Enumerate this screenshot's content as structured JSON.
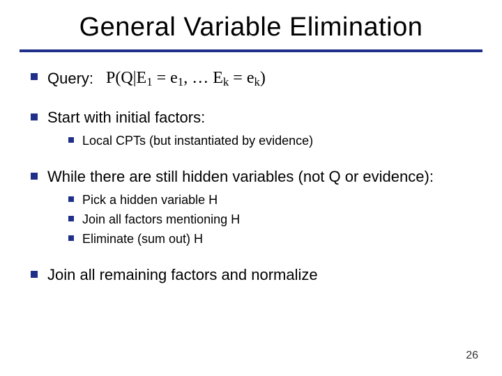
{
  "title": "General Variable Elimination",
  "bullets": {
    "b1_label": "Query:",
    "formula_plain": "P(Q | E1 = e1, … Ek = ek)",
    "b2": "Start with initial factors:",
    "b2_sub1": "Local CPTs (but instantiated by evidence)",
    "b3": "While there are still hidden variables (not Q or evidence):",
    "b3_sub1": "Pick a hidden variable H",
    "b3_sub2": "Join all factors mentioning H",
    "b3_sub3": "Eliminate (sum out) H",
    "b4": "Join all remaining factors and normalize"
  },
  "formula_parts": {
    "P": "P",
    "open": "(",
    "Q": "Q",
    "bar": "|",
    "E": "E",
    "one": "1",
    "eq": " = ",
    "e": "e",
    "comma_dots": ", … ",
    "k": "k",
    "close": ")"
  },
  "page_number": "26"
}
